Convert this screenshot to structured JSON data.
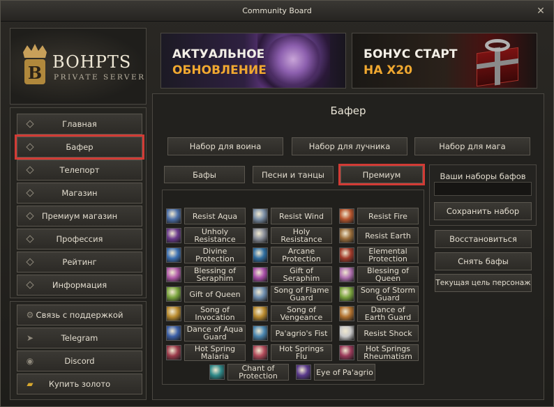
{
  "window": {
    "title": "Community Board",
    "close_glyph": "✕"
  },
  "logo": {
    "name": "BOHPTS",
    "subtitle": "PRIVATE SERVER"
  },
  "nav": [
    {
      "label": "Главная"
    },
    {
      "label": "Бафер",
      "active": true
    },
    {
      "label": "Телепорт"
    },
    {
      "label": "Магазин"
    },
    {
      "label": "Премиум магазин"
    },
    {
      "label": "Профессия"
    },
    {
      "label": "Рейтинг"
    },
    {
      "label": "Информация"
    }
  ],
  "nav_links": [
    {
      "label": "Связь с поддержкой",
      "icon": "gear-icon"
    },
    {
      "label": "Telegram",
      "icon": "telegram-icon"
    },
    {
      "label": "Discord",
      "icon": "discord-icon"
    },
    {
      "label": "Купить золото",
      "icon": "gold-icon"
    }
  ],
  "banners": [
    {
      "line1": "АКТУАЛЬНОЕ",
      "line2": "ОБНОВЛЕНИЕ"
    },
    {
      "line1": "БОНУС СТАРТ",
      "line2": "НА X20"
    }
  ],
  "page_title": "Бафер",
  "set_buttons": [
    "Набор для воина",
    "Набор для лучника",
    "Набор для мага"
  ],
  "tabs": [
    {
      "label": "Бафы"
    },
    {
      "label": "Песни и танцы"
    },
    {
      "label": "Премиум",
      "active": true
    }
  ],
  "right": {
    "sets_label": "Ваши наборы бафов",
    "sets_input_value": "",
    "save_button": "Сохранить набор",
    "restore_button": "Восстановиться",
    "remove_buffs_button": "Снять бафы",
    "current_target_button": "Текущая цель персонаж"
  },
  "buffs": [
    [
      "Resist Aqua",
      "Resist Wind",
      "Resist Fire"
    ],
    [
      "Unholy Resistance",
      "Holy Resistance",
      "Resist Earth"
    ],
    [
      "Divine Protection",
      "Arcane Protection",
      "Elemental Protection"
    ],
    [
      "Blessing of Seraphim",
      "Gift of Seraphim",
      "Blessing of Queen"
    ],
    [
      "Gift of Queen",
      "Song of Flame Guard",
      "Song of Storm Guard"
    ],
    [
      "Song of Invocation",
      "Song of Vengeance",
      "Dance of Earth Guard"
    ],
    [
      "Dance of Aqua Guard",
      "Pa'agrio's Fist",
      "Resist Shock"
    ],
    [
      "Hot Spring Malaria",
      "Hot Springs Flu",
      "Hot Springs Rheumatism"
    ],
    [
      "Chant of Protection",
      "Eye of Pa'agrio"
    ]
  ],
  "buff_icon_colors": [
    [
      "#4c6fa8",
      "#7b8fa6",
      "#b8562e"
    ],
    [
      "#6a3a8c",
      "#8a8f9a",
      "#9a6d3a"
    ],
    [
      "#3b6fb2",
      "#2f6ea0",
      "#a23a2a"
    ],
    [
      "#b05aa8",
      "#a84ea8",
      "#b070b0"
    ],
    [
      "#7aa43e",
      "#6f8fb0",
      "#7aa43e"
    ],
    [
      "#b88a2e",
      "#b88a2e",
      "#b0702e"
    ],
    [
      "#3b5fa8",
      "#4a86b0",
      "#c8c8c8"
    ],
    [
      "#9a3a4a",
      "#b04a5a",
      "#9a3a5a"
    ],
    [
      "#2f8a8a",
      "#5a3a8c"
    ]
  ]
}
